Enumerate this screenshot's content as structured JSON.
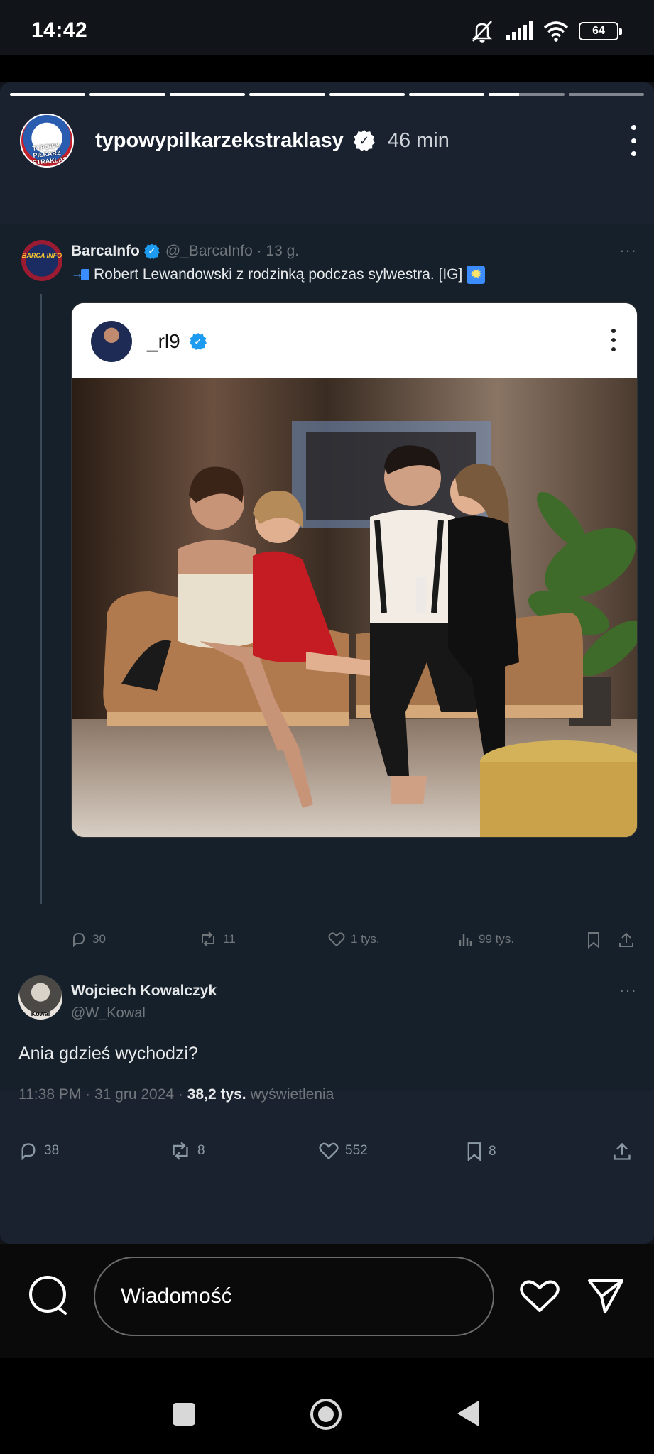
{
  "status_bar": {
    "time": "14:42",
    "battery": "64"
  },
  "story": {
    "progress_segments": 8,
    "progress_filled": 6,
    "progress_current_fraction": 0.4,
    "username": "typowypilkarzekstraklasy",
    "avatar_text": "TYPOWY PIŁKARZ EKSTRAKLASY",
    "time_ago": "46 min"
  },
  "quoted_tweet": {
    "avatar_text": "BARCA INFO",
    "name": "BarcaInfo",
    "handle_time": "@_BarcaInfo · 13 g.",
    "text": "Robert Lewandowski z rodzinką podczas sylwestra. [IG]",
    "embedded_post": {
      "username": "_rl9"
    },
    "actions": {
      "replies": "30",
      "retweets": "11",
      "likes": "1 tys.",
      "views": "99 tys."
    }
  },
  "reply_tweet": {
    "avatar_text": "Kowal",
    "name": "Wojciech Kowalczyk",
    "handle": "@W_Kowal",
    "text": "Ania gdzieś  wychodzi?",
    "meta_time": "11:38 PM · 31 gru 2024 · ",
    "meta_views": "38,2 tys.",
    "meta_views_label": " wyświetlenia",
    "actions": {
      "replies": "38",
      "retweets": "8",
      "likes": "552",
      "bookmarks": "8"
    }
  },
  "bottom_bar": {
    "message_placeholder": "Wiadomość"
  },
  "colors": {
    "accent_blue": "#1d9bf0",
    "story_bg": "#1a2230",
    "tweet_bg": "#15202b"
  }
}
